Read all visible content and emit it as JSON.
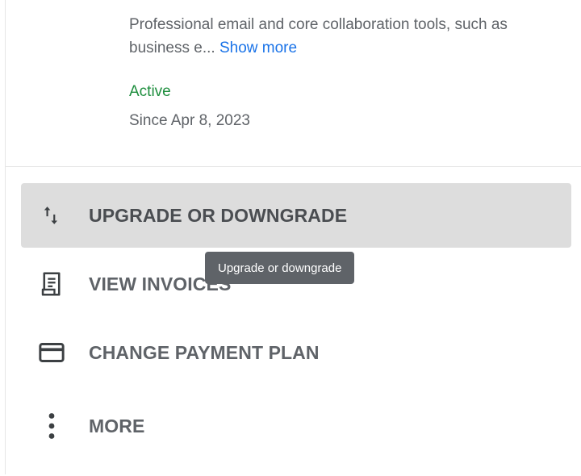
{
  "product": {
    "description": "Professional email and core collaboration tools, such as business e...",
    "show_more": "Show more",
    "status": "Active",
    "since": "Since Apr 8, 2023",
    "status_color": "#1e8e3e",
    "link_color": "#1a73e8"
  },
  "actions": [
    {
      "label": "UPGRADE OR DOWNGRADE",
      "icon": "swap-vert-icon",
      "hovered": true
    },
    {
      "label": "VIEW INVOICES",
      "icon": "receipt-icon"
    },
    {
      "label": "CHANGE PAYMENT PLAN",
      "icon": "credit-card-icon"
    },
    {
      "label": "MORE",
      "icon": "more-vert-icon"
    }
  ],
  "tooltip": {
    "text": "Upgrade or downgrade"
  },
  "colors": {
    "hover_bg": "#dddddd",
    "tooltip_bg": "#5f6368",
    "text_secondary": "#5f6368"
  }
}
